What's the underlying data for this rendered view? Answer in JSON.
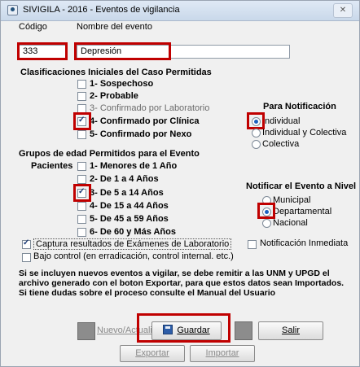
{
  "window": {
    "title": "SIVIGILA - 2016 - Eventos de vigilancia",
    "close_label": "✕"
  },
  "event": {
    "code_label": "Código",
    "name_label": "Nombre del evento",
    "code_value": "333",
    "name_value": "Depresión"
  },
  "classifications": {
    "title": "Clasificaciones Iniciales del Caso Permitidas",
    "items": [
      {
        "label": "1- Sospechoso",
        "checked": false,
        "enabled": true
      },
      {
        "label": "2- Probable",
        "checked": false,
        "enabled": true
      },
      {
        "label": "3- Confirmado por Laboratorio",
        "checked": false,
        "enabled": false
      },
      {
        "label": "4- Confirmado por Clínica",
        "checked": true,
        "enabled": true
      },
      {
        "label": "5- Confirmado por Nexo",
        "checked": false,
        "enabled": true
      }
    ]
  },
  "notification": {
    "title": "Para Notificación",
    "options": [
      {
        "label": "Individual",
        "selected": true
      },
      {
        "label": "Individual y Colectiva",
        "selected": false
      },
      {
        "label": "Colectiva",
        "selected": false
      }
    ]
  },
  "age_groups": {
    "title": "Grupos de edad Permitidos para el Evento",
    "patients_label": "Pacientes",
    "items": [
      {
        "label": "1- Menores de 1 Año",
        "checked": false
      },
      {
        "label": "2- De 1 a 4 Años",
        "checked": false
      },
      {
        "label": "3- De 5 a 14 Años",
        "checked": true
      },
      {
        "label": "4- De 15 a 44 Años",
        "checked": false
      },
      {
        "label": "5- De 45 a 59 Años",
        "checked": false
      },
      {
        "label": "6- De 60 y Más Años",
        "checked": false
      }
    ]
  },
  "notify_level": {
    "title": "Notificar el Evento a Nivel",
    "options": [
      {
        "label": "Municipal",
        "selected": false
      },
      {
        "label": "Departamental",
        "selected": true
      },
      {
        "label": "Nacional",
        "selected": false
      }
    ]
  },
  "options": {
    "capture_lab": {
      "label": "Captura resultados de Exámenes de Laboratorio",
      "checked": true
    },
    "immediate": {
      "label": "Notificación Inmediata",
      "checked": false
    },
    "low_control": {
      "label": "Bajo control (en erradicación, control internal. etc.)",
      "checked": false
    }
  },
  "note": "Si se incluyen nuevos eventos a vigilar, se debe remitir a las UNM y UPGD el archivo generado con el boton Exportar, para que estos datos sean Importados. Si tiene dudas sobre el proceso consulte el Manual del Usuario",
  "buttons": {
    "new_update": "Nuevo/Actualiza",
    "save": "Guardar",
    "exit": "Salir",
    "export": "Exportar",
    "import": "Importar"
  },
  "colors": {
    "highlight": "#c00000"
  }
}
